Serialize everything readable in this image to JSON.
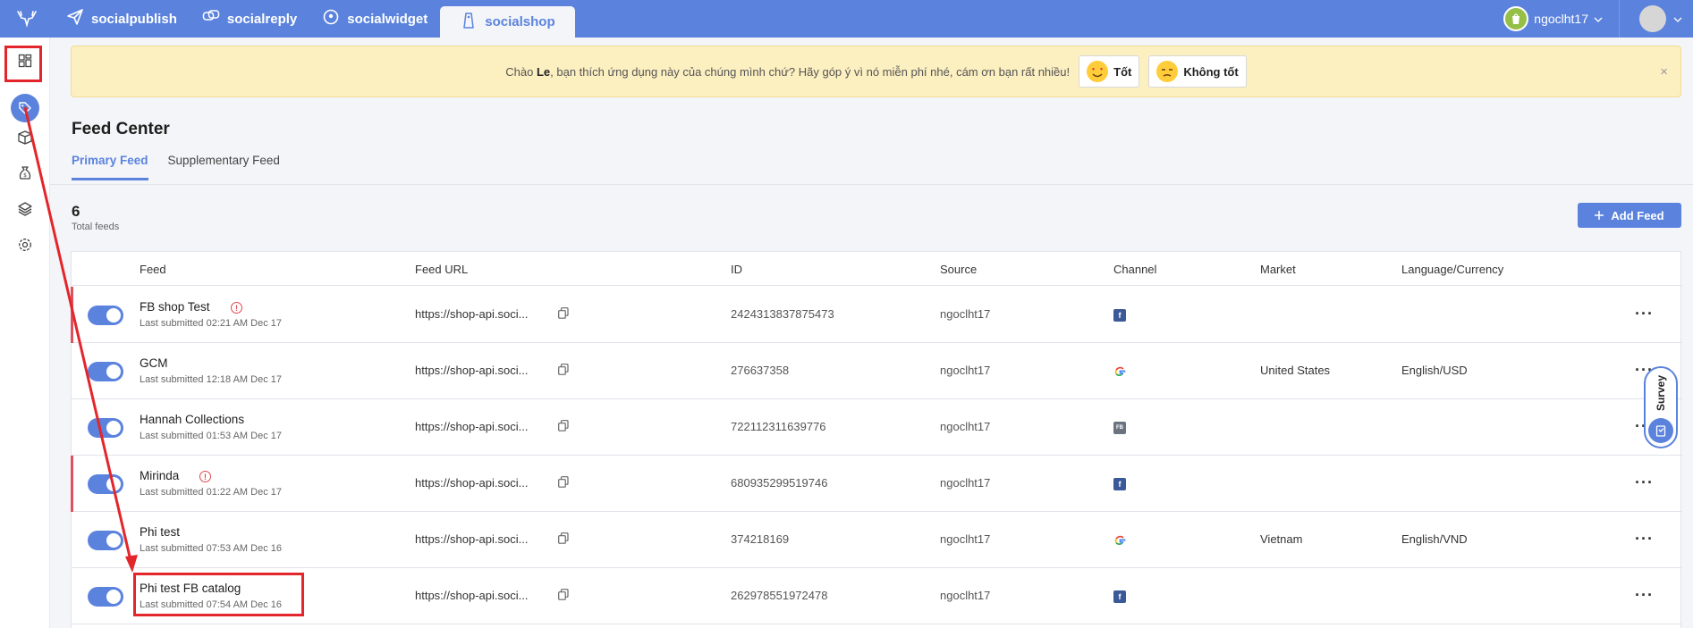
{
  "topbar": {
    "apps": [
      {
        "label": "socialpublish",
        "icon": "paper-plane-icon"
      },
      {
        "label": "socialreply",
        "icon": "chat-bubbles-icon"
      },
      {
        "label": "socialwidget",
        "icon": "widget-pin-icon"
      },
      {
        "label": "socialshop",
        "icon": "shopping-tag-icon"
      }
    ],
    "username": "ngoclht17"
  },
  "banner": {
    "text_prefix": "Chào ",
    "name": "Le",
    "text_suffix": ", bạn thích ứng dụng này của chúng mình chứ? Hãy góp ý vì nó miễn phí nhé, cám ơn bạn rất nhiều!",
    "good_label": "Tốt",
    "bad_label": "Không tốt",
    "close": "×"
  },
  "page": {
    "title": "Feed Center",
    "tabs": [
      "Primary Feed",
      "Supplementary Feed"
    ],
    "total_count": "6",
    "total_label": "Total feeds",
    "add_button": "Add Feed"
  },
  "table": {
    "headers": [
      "Feed",
      "Feed URL",
      "ID",
      "Source",
      "Channel",
      "Market",
      "Language/Currency"
    ],
    "rows": [
      {
        "name": "FB shop Test",
        "submitted": "Last submitted 02:21 AM Dec 17",
        "url": "https://shop-api.soci...",
        "id": "2424313837875473",
        "source": "ngoclht17",
        "channel": "facebook",
        "market": "",
        "language": "",
        "warning": true
      },
      {
        "name": "GCM",
        "submitted": "Last submitted 12:18 AM Dec 17",
        "url": "https://shop-api.soci...",
        "id": "276637358",
        "source": "ngoclht17",
        "channel": "google",
        "market": "United States",
        "language": "English/USD",
        "warning": false
      },
      {
        "name": "Hannah Collections",
        "submitted": "Last submitted 01:53 AM Dec 17",
        "url": "https://shop-api.soci...",
        "id": "722112311639776",
        "source": "ngoclht17",
        "channel": "fb-feed",
        "market": "",
        "language": "",
        "warning": false
      },
      {
        "name": "Mirinda",
        "submitted": "Last submitted 01:22 AM Dec 17",
        "url": "https://shop-api.soci...",
        "id": "680935299519746",
        "source": "ngoclht17",
        "channel": "facebook",
        "market": "",
        "language": "",
        "warning": true
      },
      {
        "name": "Phi test",
        "submitted": "Last submitted 07:53 AM Dec 16",
        "url": "https://shop-api.soci...",
        "id": "374218169",
        "source": "ngoclht17",
        "channel": "google",
        "market": "Vietnam",
        "language": "English/VND",
        "warning": false
      },
      {
        "name": "Phi test FB catalog",
        "submitted": "Last submitted 07:54 AM Dec 16",
        "url": "https://shop-api.soci...",
        "id": "262978551972478",
        "source": "ngoclht17",
        "channel": "facebook",
        "market": "",
        "language": "",
        "warning": false
      }
    ]
  },
  "survey": {
    "label": "Survey"
  },
  "colors": {
    "primary": "#5b83dd",
    "annotation_red": "#e3262b",
    "banner_bg": "#fcefc0"
  }
}
